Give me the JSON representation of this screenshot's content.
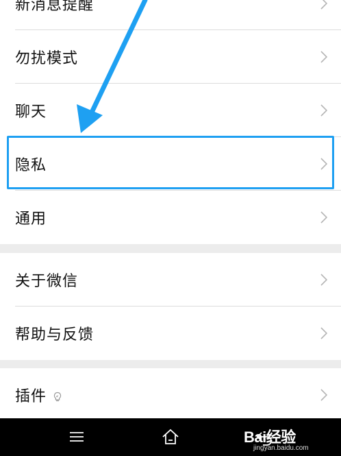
{
  "settings": {
    "group1": [
      {
        "label": "新消息提醒"
      },
      {
        "label": "勿扰模式"
      },
      {
        "label": "聊天"
      },
      {
        "label": "隐私"
      },
      {
        "label": "通用"
      }
    ],
    "group2": [
      {
        "label": "关于微信"
      },
      {
        "label": "帮助与反馈"
      }
    ],
    "group3": [
      {
        "label": "插件"
      }
    ]
  },
  "annotation": {
    "highlight_target": "隐私",
    "color": "#1ea0f2"
  },
  "navbar": {
    "buttons": [
      "menu-icon",
      "home-icon",
      "back-icon"
    ]
  },
  "watermark": {
    "logo": "Bai经验",
    "url": "jingyan.baidu.com"
  },
  "colors": {
    "background": "#ececec",
    "row": "#ffffff",
    "divider": "#dcdcdc",
    "chevron": "#b5b5b5",
    "navbar": "#000000"
  }
}
